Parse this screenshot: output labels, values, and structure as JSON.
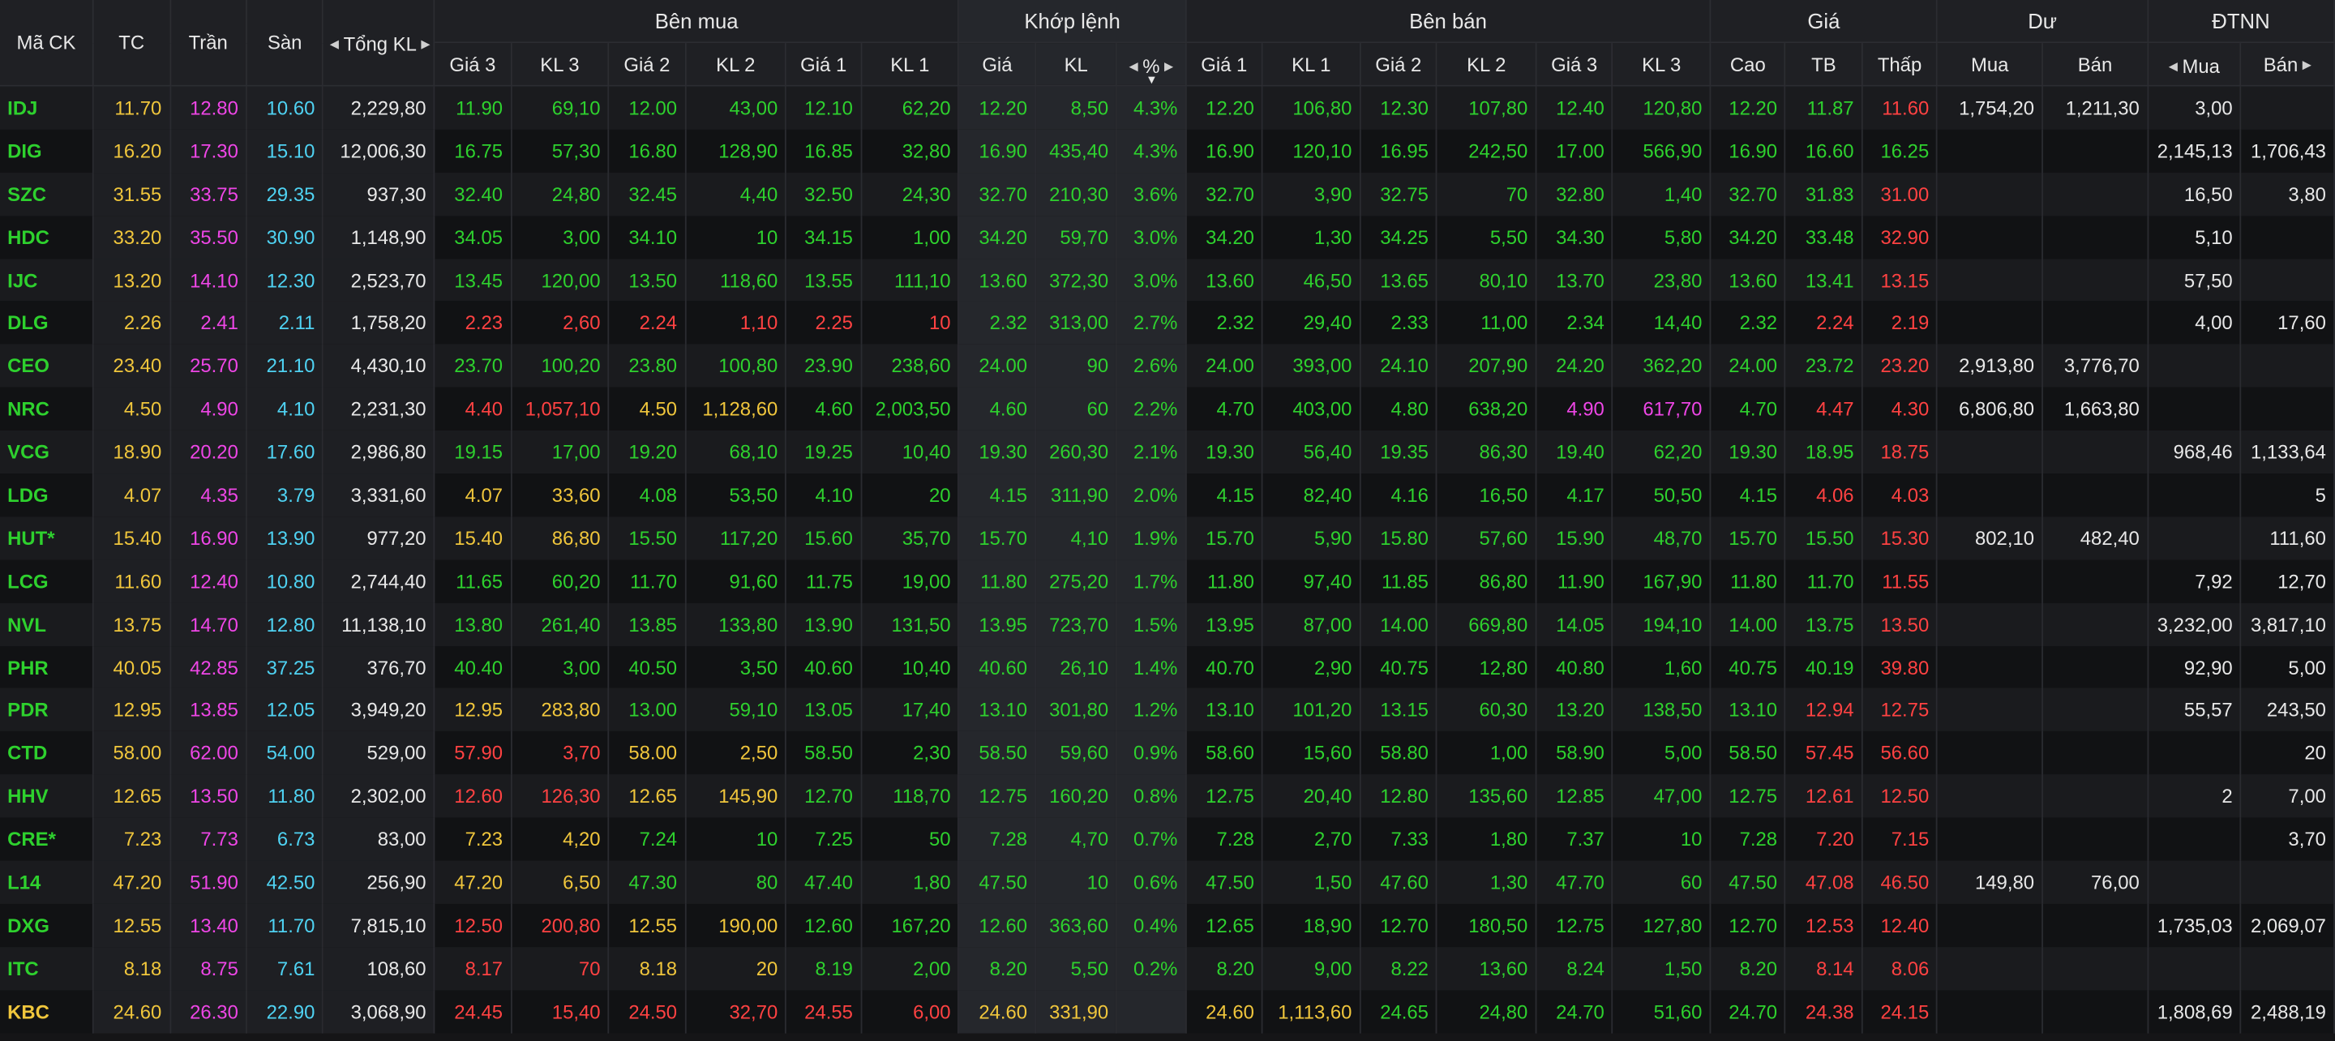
{
  "header": {
    "symbol": "Mã CK",
    "ref": "TC",
    "ceil": "Trần",
    "floor": "Sàn",
    "total_vol": "Tổng KL",
    "buy_group": "Bên mua",
    "match_group": "Khớp lệnh",
    "sell_group": "Bên bán",
    "price_group": "Giá",
    "residual_group": "Dư",
    "foreign_group": "ĐTNN",
    "b3": "Giá 3",
    "bv3": "KL 3",
    "b2": "Giá 2",
    "bv2": "KL 2",
    "b1": "Giá 1",
    "bv1": "KL 1",
    "m_price": "Giá",
    "m_vol": "KL",
    "m_pct": "%",
    "s1": "Giá 1",
    "sv1": "KL 1",
    "s2": "Giá 2",
    "sv2": "KL 2",
    "s3": "Giá 3",
    "sv3": "KL 3",
    "high": "Cao",
    "avg": "TB",
    "low": "Thấp",
    "res_buy": "Mua",
    "res_sell": "Bán",
    "f_buy": "Mua",
    "f_sell": "Bán"
  },
  "colors": {
    "ceil": "#ee46e6",
    "floor": "#4fd2f2",
    "ref": "#f0c63c",
    "up": "#2ed12e",
    "down": "#ff4242",
    "neutral": "#e8e8e8"
  },
  "rows": [
    {
      "sym": "IDJ",
      "sc": "green",
      "tc": "11.70",
      "tran": "12.80",
      "san": "10.60",
      "tkl": "2,229,80",
      "b3": "11.90",
      "b3c": "green",
      "bv3": "69,10",
      "b2": "12.00",
      "b2c": "green",
      "bv2": "43,00",
      "b1": "12.10",
      "b1c": "green",
      "bv1": "62,20",
      "mp": "12.20",
      "mc": "green",
      "mv": "8,50",
      "pct": "4.3%",
      "s1": "12.20",
      "s1c": "green",
      "sv1": "106,80",
      "s2": "12.30",
      "s2c": "green",
      "sv2": "107,80",
      "s3": "12.40",
      "s3c": "green",
      "sv3": "120,80",
      "hi": "12.20",
      "hic": "green",
      "av": "11.87",
      "avc": "green",
      "lo": "11.60",
      "loc": "red",
      "rb": "1,754,20",
      "rs": "1,211,30",
      "fb": "3,00",
      "fs": ""
    },
    {
      "sym": "DIG",
      "sc": "green",
      "tc": "16.20",
      "tran": "17.30",
      "san": "15.10",
      "tkl": "12,006,30",
      "b3": "16.75",
      "b3c": "green",
      "bv3": "57,30",
      "b2": "16.80",
      "b2c": "green",
      "bv2": "128,90",
      "b1": "16.85",
      "b1c": "green",
      "bv1": "32,80",
      "mp": "16.90",
      "mc": "green",
      "mv": "435,40",
      "pct": "4.3%",
      "s1": "16.90",
      "s1c": "green",
      "sv1": "120,10",
      "s2": "16.95",
      "s2c": "green",
      "sv2": "242,50",
      "s3": "17.00",
      "s3c": "green",
      "sv3": "566,90",
      "hi": "16.90",
      "hic": "green",
      "av": "16.60",
      "avc": "green",
      "lo": "16.25",
      "loc": "green",
      "rb": "",
      "rs": "",
      "fb": "2,145,13",
      "fs": "1,706,43"
    },
    {
      "sym": "SZC",
      "sc": "green",
      "tc": "31.55",
      "tran": "33.75",
      "san": "29.35",
      "tkl": "937,30",
      "b3": "32.40",
      "b3c": "green",
      "bv3": "24,80",
      "b2": "32.45",
      "b2c": "green",
      "bv2": "4,40",
      "b1": "32.50",
      "b1c": "green",
      "bv1": "24,30",
      "mp": "32.70",
      "mc": "green",
      "mv": "210,30",
      "pct": "3.6%",
      "s1": "32.70",
      "s1c": "green",
      "sv1": "3,90",
      "s2": "32.75",
      "s2c": "green",
      "sv2": "70",
      "s3": "32.80",
      "s3c": "green",
      "sv3": "1,40",
      "hi": "32.70",
      "hic": "green",
      "av": "31.83",
      "avc": "green",
      "lo": "31.00",
      "loc": "red",
      "rb": "",
      "rs": "",
      "fb": "16,50",
      "fs": "3,80"
    },
    {
      "sym": "HDC",
      "sc": "green",
      "tc": "33.20",
      "tran": "35.50",
      "san": "30.90",
      "tkl": "1,148,90",
      "b3": "34.05",
      "b3c": "green",
      "bv3": "3,00",
      "b2": "34.10",
      "b2c": "green",
      "bv2": "10",
      "b1": "34.15",
      "b1c": "green",
      "bv1": "1,00",
      "mp": "34.20",
      "mc": "green",
      "mv": "59,70",
      "pct": "3.0%",
      "s1": "34.20",
      "s1c": "green",
      "sv1": "1,30",
      "s2": "34.25",
      "s2c": "green",
      "sv2": "5,50",
      "s3": "34.30",
      "s3c": "green",
      "sv3": "5,80",
      "hi": "34.20",
      "hic": "green",
      "av": "33.48",
      "avc": "green",
      "lo": "32.90",
      "loc": "red",
      "rb": "",
      "rs": "",
      "fb": "5,10",
      "fs": ""
    },
    {
      "sym": "IJC",
      "sc": "green",
      "tc": "13.20",
      "tran": "14.10",
      "san": "12.30",
      "tkl": "2,523,70",
      "b3": "13.45",
      "b3c": "green",
      "bv3": "120,00",
      "b2": "13.50",
      "b2c": "green",
      "bv2": "118,60",
      "b1": "13.55",
      "b1c": "green",
      "bv1": "111,10",
      "mp": "13.60",
      "mc": "green",
      "mv": "372,30",
      "pct": "3.0%",
      "s1": "13.60",
      "s1c": "green",
      "sv1": "46,50",
      "s2": "13.65",
      "s2c": "green",
      "sv2": "80,10",
      "s3": "13.70",
      "s3c": "green",
      "sv3": "23,80",
      "hi": "13.60",
      "hic": "green",
      "av": "13.41",
      "avc": "green",
      "lo": "13.15",
      "loc": "red",
      "rb": "",
      "rs": "",
      "fb": "57,50",
      "fs": ""
    },
    {
      "sym": "DLG",
      "sc": "green",
      "tc": "2.26",
      "tran": "2.41",
      "san": "2.11",
      "tkl": "1,758,20",
      "b3": "2.23",
      "b3c": "red",
      "bv3": "2,60",
      "b2": "2.24",
      "b2c": "red",
      "bv2": "1,10",
      "b1": "2.25",
      "b1c": "red",
      "bv1": "10",
      "mp": "2.32",
      "mc": "green",
      "mv": "313,00",
      "pct": "2.7%",
      "s1": "2.32",
      "s1c": "green",
      "sv1": "29,40",
      "s2": "2.33",
      "s2c": "green",
      "sv2": "11,00",
      "s3": "2.34",
      "s3c": "green",
      "sv3": "14,40",
      "hi": "2.32",
      "hic": "green",
      "av": "2.24",
      "avc": "red",
      "lo": "2.19",
      "loc": "red",
      "rb": "",
      "rs": "",
      "fb": "4,00",
      "fs": "17,60"
    },
    {
      "sym": "CEO",
      "sc": "green",
      "tc": "23.40",
      "tran": "25.70",
      "san": "21.10",
      "tkl": "4,430,10",
      "b3": "23.70",
      "b3c": "green",
      "bv3": "100,20",
      "b2": "23.80",
      "b2c": "green",
      "bv2": "100,80",
      "b1": "23.90",
      "b1c": "green",
      "bv1": "238,60",
      "mp": "24.00",
      "mc": "green",
      "mv": "90",
      "pct": "2.6%",
      "s1": "24.00",
      "s1c": "green",
      "sv1": "393,00",
      "s2": "24.10",
      "s2c": "green",
      "sv2": "207,90",
      "s3": "24.20",
      "s3c": "green",
      "sv3": "362,20",
      "hi": "24.00",
      "hic": "green",
      "av": "23.72",
      "avc": "green",
      "lo": "23.20",
      "loc": "red",
      "rb": "2,913,80",
      "rs": "3,776,70",
      "fb": "",
      "fs": ""
    },
    {
      "sym": "NRC",
      "sc": "green",
      "tc": "4.50",
      "tran": "4.90",
      "san": "4.10",
      "tkl": "2,231,30",
      "b3": "4.40",
      "b3c": "red",
      "bv3": "1,057,10",
      "b2": "4.50",
      "b2c": "yellow",
      "bv2": "1,128,60",
      "b1": "4.60",
      "b1c": "green",
      "bv1": "2,003,50",
      "mp": "4.60",
      "mc": "green",
      "mv": "60",
      "pct": "2.2%",
      "s1": "4.70",
      "s1c": "green",
      "sv1": "403,00",
      "s2": "4.80",
      "s2c": "green",
      "sv2": "638,20",
      "s3": "4.90",
      "s3c": "magenta",
      "sv3": "617,70",
      "hi": "4.70",
      "hic": "green",
      "av": "4.47",
      "avc": "red",
      "lo": "4.30",
      "loc": "red",
      "rb": "6,806,80",
      "rs": "1,663,80",
      "fb": "",
      "fs": ""
    },
    {
      "sym": "VCG",
      "sc": "green",
      "tc": "18.90",
      "tran": "20.20",
      "san": "17.60",
      "tkl": "2,986,80",
      "b3": "19.15",
      "b3c": "green",
      "bv3": "17,00",
      "b2": "19.20",
      "b2c": "green",
      "bv2": "68,10",
      "b1": "19.25",
      "b1c": "green",
      "bv1": "10,40",
      "mp": "19.30",
      "mc": "green",
      "mv": "260,30",
      "pct": "2.1%",
      "s1": "19.30",
      "s1c": "green",
      "sv1": "56,40",
      "s2": "19.35",
      "s2c": "green",
      "sv2": "86,30",
      "s3": "19.40",
      "s3c": "green",
      "sv3": "62,20",
      "hi": "19.30",
      "hic": "green",
      "av": "18.95",
      "avc": "green",
      "lo": "18.75",
      "loc": "red",
      "rb": "",
      "rs": "",
      "fb": "968,46",
      "fs": "1,133,64"
    },
    {
      "sym": "LDG",
      "sc": "green",
      "tc": "4.07",
      "tran": "4.35",
      "san": "3.79",
      "tkl": "3,331,60",
      "b3": "4.07",
      "b3c": "yellow",
      "bv3": "33,60",
      "b2": "4.08",
      "b2c": "green",
      "bv2": "53,50",
      "b1": "4.10",
      "b1c": "green",
      "bv1": "20",
      "mp": "4.15",
      "mc": "green",
      "mv": "311,90",
      "pct": "2.0%",
      "s1": "4.15",
      "s1c": "green",
      "sv1": "82,40",
      "s2": "4.16",
      "s2c": "green",
      "sv2": "16,50",
      "s3": "4.17",
      "s3c": "green",
      "sv3": "50,50",
      "hi": "4.15",
      "hic": "green",
      "av": "4.06",
      "avc": "red",
      "lo": "4.03",
      "loc": "red",
      "rb": "",
      "rs": "",
      "fb": "",
      "fs": "5"
    },
    {
      "sym": "HUT*",
      "sc": "green",
      "tc": "15.40",
      "tran": "16.90",
      "san": "13.90",
      "tkl": "977,20",
      "b3": "15.40",
      "b3c": "yellow",
      "bv3": "86,80",
      "b2": "15.50",
      "b2c": "green",
      "bv2": "117,20",
      "b1": "15.60",
      "b1c": "green",
      "bv1": "35,70",
      "mp": "15.70",
      "mc": "green",
      "mv": "4,10",
      "pct": "1.9%",
      "s1": "15.70",
      "s1c": "green",
      "sv1": "5,90",
      "s2": "15.80",
      "s2c": "green",
      "sv2": "57,60",
      "s3": "15.90",
      "s3c": "green",
      "sv3": "48,70",
      "hi": "15.70",
      "hic": "green",
      "av": "15.50",
      "avc": "green",
      "lo": "15.30",
      "loc": "red",
      "rb": "802,10",
      "rs": "482,40",
      "fb": "",
      "fs": "111,60"
    },
    {
      "sym": "LCG",
      "sc": "green",
      "tc": "11.60",
      "tran": "12.40",
      "san": "10.80",
      "tkl": "2,744,40",
      "b3": "11.65",
      "b3c": "green",
      "bv3": "60,20",
      "b2": "11.70",
      "b2c": "green",
      "bv2": "91,60",
      "b1": "11.75",
      "b1c": "green",
      "bv1": "19,00",
      "mp": "11.80",
      "mc": "green",
      "mv": "275,20",
      "pct": "1.7%",
      "s1": "11.80",
      "s1c": "green",
      "sv1": "97,40",
      "s2": "11.85",
      "s2c": "green",
      "sv2": "86,80",
      "s3": "11.90",
      "s3c": "green",
      "sv3": "167,90",
      "hi": "11.80",
      "hic": "green",
      "av": "11.70",
      "avc": "green",
      "lo": "11.55",
      "loc": "red",
      "rb": "",
      "rs": "",
      "fb": "7,92",
      "fs": "12,70"
    },
    {
      "sym": "NVL",
      "sc": "green",
      "tc": "13.75",
      "tran": "14.70",
      "san": "12.80",
      "tkl": "11,138,10",
      "b3": "13.80",
      "b3c": "green",
      "bv3": "261,40",
      "b2": "13.85",
      "b2c": "green",
      "bv2": "133,80",
      "b1": "13.90",
      "b1c": "green",
      "bv1": "131,50",
      "mp": "13.95",
      "mc": "green",
      "mv": "723,70",
      "pct": "1.5%",
      "s1": "13.95",
      "s1c": "green",
      "sv1": "87,00",
      "s2": "14.00",
      "s2c": "green",
      "sv2": "669,80",
      "s3": "14.05",
      "s3c": "green",
      "sv3": "194,10",
      "hi": "14.00",
      "hic": "green",
      "av": "13.75",
      "avc": "green",
      "lo": "13.50",
      "loc": "red",
      "rb": "",
      "rs": "",
      "fb": "3,232,00",
      "fs": "3,817,10"
    },
    {
      "sym": "PHR",
      "sc": "green",
      "tc": "40.05",
      "tran": "42.85",
      "san": "37.25",
      "tkl": "376,70",
      "b3": "40.40",
      "b3c": "green",
      "bv3": "3,00",
      "b2": "40.50",
      "b2c": "green",
      "bv2": "3,50",
      "b1": "40.60",
      "b1c": "green",
      "bv1": "10,40",
      "mp": "40.60",
      "mc": "green",
      "mv": "26,10",
      "pct": "1.4%",
      "s1": "40.70",
      "s1c": "green",
      "sv1": "2,90",
      "s2": "40.75",
      "s2c": "green",
      "sv2": "12,80",
      "s3": "40.80",
      "s3c": "green",
      "sv3": "1,60",
      "hi": "40.75",
      "hic": "green",
      "av": "40.19",
      "avc": "green",
      "lo": "39.80",
      "loc": "red",
      "rb": "",
      "rs": "",
      "fb": "92,90",
      "fs": "5,00"
    },
    {
      "sym": "PDR",
      "sc": "green",
      "tc": "12.95",
      "tran": "13.85",
      "san": "12.05",
      "tkl": "3,949,20",
      "b3": "12.95",
      "b3c": "yellow",
      "bv3": "283,80",
      "b2": "13.00",
      "b2c": "green",
      "bv2": "59,10",
      "b1": "13.05",
      "b1c": "green",
      "bv1": "17,40",
      "mp": "13.10",
      "mc": "green",
      "mv": "301,80",
      "pct": "1.2%",
      "s1": "13.10",
      "s1c": "green",
      "sv1": "101,20",
      "s2": "13.15",
      "s2c": "green",
      "sv2": "60,30",
      "s3": "13.20",
      "s3c": "green",
      "sv3": "138,50",
      "hi": "13.10",
      "hic": "green",
      "av": "12.94",
      "avc": "red",
      "lo": "12.75",
      "loc": "red",
      "rb": "",
      "rs": "",
      "fb": "55,57",
      "fs": "243,50"
    },
    {
      "sym": "CTD",
      "sc": "green",
      "tc": "58.00",
      "tran": "62.00",
      "san": "54.00",
      "tkl": "529,00",
      "b3": "57.90",
      "b3c": "red",
      "bv3": "3,70",
      "b2": "58.00",
      "b2c": "yellow",
      "bv2": "2,50",
      "b1": "58.50",
      "b1c": "green",
      "bv1": "2,30",
      "mp": "58.50",
      "mc": "green",
      "mv": "59,60",
      "pct": "0.9%",
      "s1": "58.60",
      "s1c": "green",
      "sv1": "15,60",
      "s2": "58.80",
      "s2c": "green",
      "sv2": "1,00",
      "s3": "58.90",
      "s3c": "green",
      "sv3": "5,00",
      "hi": "58.50",
      "hic": "green",
      "av": "57.45",
      "avc": "red",
      "lo": "56.60",
      "loc": "red",
      "rb": "",
      "rs": "",
      "fb": "",
      "fs": "20"
    },
    {
      "sym": "HHV",
      "sc": "green",
      "tc": "12.65",
      "tran": "13.50",
      "san": "11.80",
      "tkl": "2,302,00",
      "b3": "12.60",
      "b3c": "red",
      "bv3": "126,30",
      "b2": "12.65",
      "b2c": "yellow",
      "bv2": "145,90",
      "b1": "12.70",
      "b1c": "green",
      "bv1": "118,70",
      "mp": "12.75",
      "mc": "green",
      "mv": "160,20",
      "pct": "0.8%",
      "s1": "12.75",
      "s1c": "green",
      "sv1": "20,40",
      "s2": "12.80",
      "s2c": "green",
      "sv2": "135,60",
      "s3": "12.85",
      "s3c": "green",
      "sv3": "47,00",
      "hi": "12.75",
      "hic": "green",
      "av": "12.61",
      "avc": "red",
      "lo": "12.50",
      "loc": "red",
      "rb": "",
      "rs": "",
      "fb": "2",
      "fs": "7,00"
    },
    {
      "sym": "CRE*",
      "sc": "green",
      "tc": "7.23",
      "tran": "7.73",
      "san": "6.73",
      "tkl": "83,00",
      "b3": "7.23",
      "b3c": "yellow",
      "bv3": "4,20",
      "b2": "7.24",
      "b2c": "green",
      "bv2": "10",
      "b1": "7.25",
      "b1c": "green",
      "bv1": "50",
      "mp": "7.28",
      "mc": "green",
      "mv": "4,70",
      "pct": "0.7%",
      "s1": "7.28",
      "s1c": "green",
      "sv1": "2,70",
      "s2": "7.33",
      "s2c": "green",
      "sv2": "1,80",
      "s3": "7.37",
      "s3c": "green",
      "sv3": "10",
      "hi": "7.28",
      "hic": "green",
      "av": "7.20",
      "avc": "red",
      "lo": "7.15",
      "loc": "red",
      "rb": "",
      "rs": "",
      "fb": "",
      "fs": "3,70"
    },
    {
      "sym": "L14",
      "sc": "green",
      "tc": "47.20",
      "tran": "51.90",
      "san": "42.50",
      "tkl": "256,90",
      "b3": "47.20",
      "b3c": "yellow",
      "bv3": "6,50",
      "b2": "47.30",
      "b2c": "green",
      "bv2": "80",
      "b1": "47.40",
      "b1c": "green",
      "bv1": "1,80",
      "mp": "47.50",
      "mc": "green",
      "mv": "10",
      "pct": "0.6%",
      "s1": "47.50",
      "s1c": "green",
      "sv1": "1,50",
      "s2": "47.60",
      "s2c": "green",
      "sv2": "1,30",
      "s3": "47.70",
      "s3c": "green",
      "sv3": "60",
      "hi": "47.50",
      "hic": "green",
      "av": "47.08",
      "avc": "red",
      "lo": "46.50",
      "loc": "red",
      "rb": "149,80",
      "rs": "76,00",
      "fb": "",
      "fs": ""
    },
    {
      "sym": "DXG",
      "sc": "green",
      "tc": "12.55",
      "tran": "13.40",
      "san": "11.70",
      "tkl": "7,815,10",
      "b3": "12.50",
      "b3c": "red",
      "bv3": "200,80",
      "b2": "12.55",
      "b2c": "yellow",
      "bv2": "190,00",
      "b1": "12.60",
      "b1c": "green",
      "bv1": "167,20",
      "mp": "12.60",
      "mc": "green",
      "mv": "363,60",
      "pct": "0.4%",
      "s1": "12.65",
      "s1c": "green",
      "sv1": "18,90",
      "s2": "12.70",
      "s2c": "green",
      "sv2": "180,50",
      "s3": "12.75",
      "s3c": "green",
      "sv3": "127,80",
      "hi": "12.70",
      "hic": "green",
      "av": "12.53",
      "avc": "red",
      "lo": "12.40",
      "loc": "red",
      "rb": "",
      "rs": "",
      "fb": "1,735,03",
      "fs": "2,069,07"
    },
    {
      "sym": "ITC",
      "sc": "green",
      "tc": "8.18",
      "tran": "8.75",
      "san": "7.61",
      "tkl": "108,60",
      "b3": "8.17",
      "b3c": "red",
      "bv3": "70",
      "b2": "8.18",
      "b2c": "yellow",
      "bv2": "20",
      "b1": "8.19",
      "b1c": "green",
      "bv1": "2,00",
      "mp": "8.20",
      "mc": "green",
      "mv": "5,50",
      "pct": "0.2%",
      "s1": "8.20",
      "s1c": "green",
      "sv1": "9,00",
      "s2": "8.22",
      "s2c": "green",
      "sv2": "13,60",
      "s3": "8.24",
      "s3c": "green",
      "sv3": "1,50",
      "hi": "8.20",
      "hic": "green",
      "av": "8.14",
      "avc": "red",
      "lo": "8.06",
      "loc": "red",
      "rb": "",
      "rs": "",
      "fb": "",
      "fs": ""
    },
    {
      "sym": "KBC",
      "sc": "yellow",
      "tc": "24.60",
      "tran": "26.30",
      "san": "22.90",
      "tkl": "3,068,90",
      "b3": "24.45",
      "b3c": "red",
      "bv3": "15,40",
      "b2": "24.50",
      "b2c": "red",
      "bv2": "32,70",
      "b1": "24.55",
      "b1c": "red",
      "bv1": "6,00",
      "mp": "24.60",
      "mc": "yellow",
      "mv": "331,90",
      "pct": "",
      "s1": "24.60",
      "s1c": "yellow",
      "sv1": "1,113,60",
      "s2": "24.65",
      "s2c": "green",
      "sv2": "24,80",
      "s3": "24.70",
      "s3c": "green",
      "sv3": "51,60",
      "hi": "24.70",
      "hic": "green",
      "av": "24.38",
      "avc": "red",
      "lo": "24.15",
      "loc": "red",
      "rb": "",
      "rs": "",
      "fb": "1,808,69",
      "fs": "2,488,19"
    }
  ]
}
